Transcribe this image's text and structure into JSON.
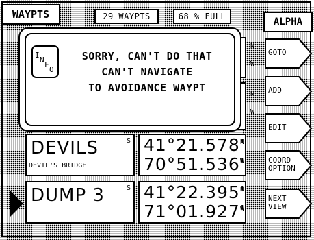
{
  "header": {
    "title": "WAYPTS",
    "count": "29 WAYPTS",
    "memory": "68 % FULL",
    "mode": "ALPHA"
  },
  "background_rows": [
    {
      "lat_hemi": "N",
      "lon_hemi": "W"
    },
    {
      "lat_hemi": "N",
      "lon_hemi": "W"
    }
  ],
  "waypoints": [
    {
      "name": "DEVILS",
      "symbol": "S",
      "comment": "DEVIL'S BRIDGE",
      "lat": "41°21.578'",
      "lat_hemi": "N",
      "lon": "70°51.536'",
      "lon_hemi": "W"
    },
    {
      "name": "DUMP 3",
      "symbol": "S",
      "comment": "",
      "lat": "41°22.395'",
      "lat_hemi": "N",
      "lon": "71°01.927'",
      "lon_hemi": "W"
    }
  ],
  "softkeys": [
    "GOTO",
    "ADD",
    "EDIT",
    "COORD OPTION",
    "NEXT VIEW"
  ],
  "dialog": {
    "icon_text": "INFO",
    "line1": "SORRY, CAN'T DO THAT",
    "line2": "CAN'T NAVIGATE",
    "line3": "TO AVOIDANCE WAYPT"
  },
  "selection_pointer": "right-triangle-icon"
}
